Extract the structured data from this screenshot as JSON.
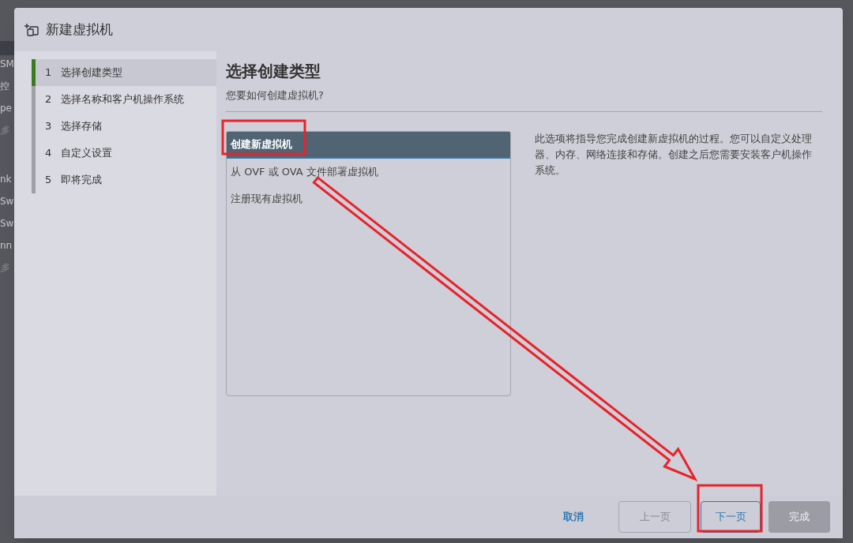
{
  "background_page": {
    "sidebar_fragments": [
      {
        "text": "SM",
        "italic": false
      },
      {
        "text": "控",
        "italic": false
      },
      {
        "text": "pe",
        "italic": false
      },
      {
        "text": "多",
        "italic": true
      },
      {
        "text": "nk",
        "italic": false
      },
      {
        "text": "Sw",
        "italic": false
      },
      {
        "text": "Sw",
        "italic": false
      },
      {
        "text": "nn",
        "italic": false
      },
      {
        "text": "多",
        "italic": true
      }
    ]
  },
  "dialog": {
    "title": "新建虚拟机",
    "steps": [
      {
        "number": "1",
        "label": "选择创建类型",
        "selected": true
      },
      {
        "number": "2",
        "label": "选择名称和客户机操作系统",
        "selected": false
      },
      {
        "number": "3",
        "label": "选择存储",
        "selected": false
      },
      {
        "number": "4",
        "label": "自定义设置",
        "selected": false
      },
      {
        "number": "5",
        "label": "即将完成",
        "selected": false
      }
    ],
    "heading": "选择创建类型",
    "subheading": "您要如何创建虚拟机?",
    "options": [
      {
        "label": "创建新虚拟机",
        "selected": true
      },
      {
        "label": "从 OVF 或 OVA 文件部署虚拟机",
        "selected": false
      },
      {
        "label": "注册现有虚拟机",
        "selected": false
      }
    ],
    "description": "此选项将指导您完成创建新虚拟机的过程。您可以自定义处理器、内存、网络连接和存储。创建之后您需要安装客户机操作系统。",
    "buttons": [
      {
        "kind": "link",
        "label": "取消",
        "disabled": false
      },
      {
        "kind": "outline",
        "label": "上一页",
        "disabled": true
      },
      {
        "kind": "outline",
        "label": "下一页",
        "disabled": false
      },
      {
        "kind": "primary",
        "label": "完成",
        "disabled": true
      }
    ]
  }
}
